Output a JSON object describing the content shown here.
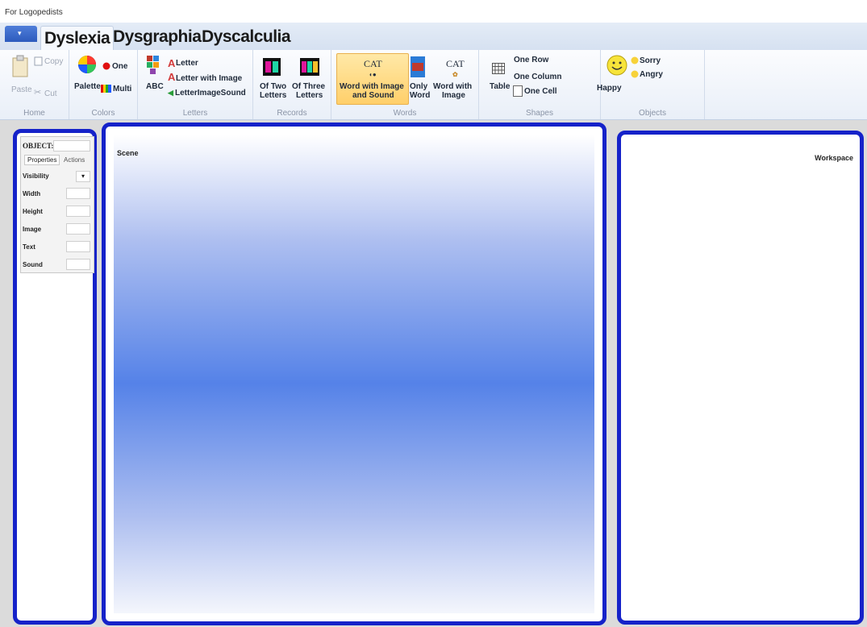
{
  "window": {
    "title": "For Logopedists"
  },
  "tabs": [
    {
      "label": "Dyslexia",
      "active": true
    },
    {
      "label": "Dysgraphia",
      "active": false
    },
    {
      "label": "Dyscalculia",
      "active": false
    }
  ],
  "ribbon": {
    "home": {
      "group": "Home",
      "paste": "Paste",
      "copy": "Copy",
      "cut": "Cut"
    },
    "colors": {
      "group": "Colors",
      "palette": "Palette",
      "one": "One",
      "multi": "Multi"
    },
    "letters": {
      "group": "Letters",
      "abc": "ABC",
      "letter": "Letter",
      "letter_with_image": "Letter with Image",
      "letter_image_sound": "LetterImageSound"
    },
    "records": {
      "group": "Records",
      "of_two": "Of Two\nLetters",
      "of_two_l1": "Of Two",
      "of_two_l2": "Letters",
      "of_three_l1": "Of Three",
      "of_three_l2": "Letters"
    },
    "words": {
      "group": "Words",
      "wis_l1": "Word with Image",
      "wis_l2": "and Sound",
      "only_l1": "Only",
      "only_l2": "Word",
      "wwi_l1": "Word with",
      "wwi_l2": "Image",
      "cat": "CAT"
    },
    "shapes": {
      "group": "Shapes",
      "table": "Table",
      "one_row": "One Row",
      "one_column": "One Column",
      "one_cell": "One Cell"
    },
    "objects": {
      "group": "Objects",
      "happy": "Happy",
      "sorry": "Sorry",
      "angry": "Angry"
    }
  },
  "properties": {
    "object_label": "OBJECT:",
    "tabs": [
      "Properties",
      "Actions"
    ],
    "rows": [
      "Visibility",
      "Width",
      "Height",
      "Image",
      "Text",
      "Sound"
    ]
  },
  "scene": {
    "label": "Scene"
  },
  "workspace": {
    "label": "Workspace"
  },
  "colors": {
    "panel_border": "#1522c9",
    "scene_mid": "#5582e8"
  }
}
